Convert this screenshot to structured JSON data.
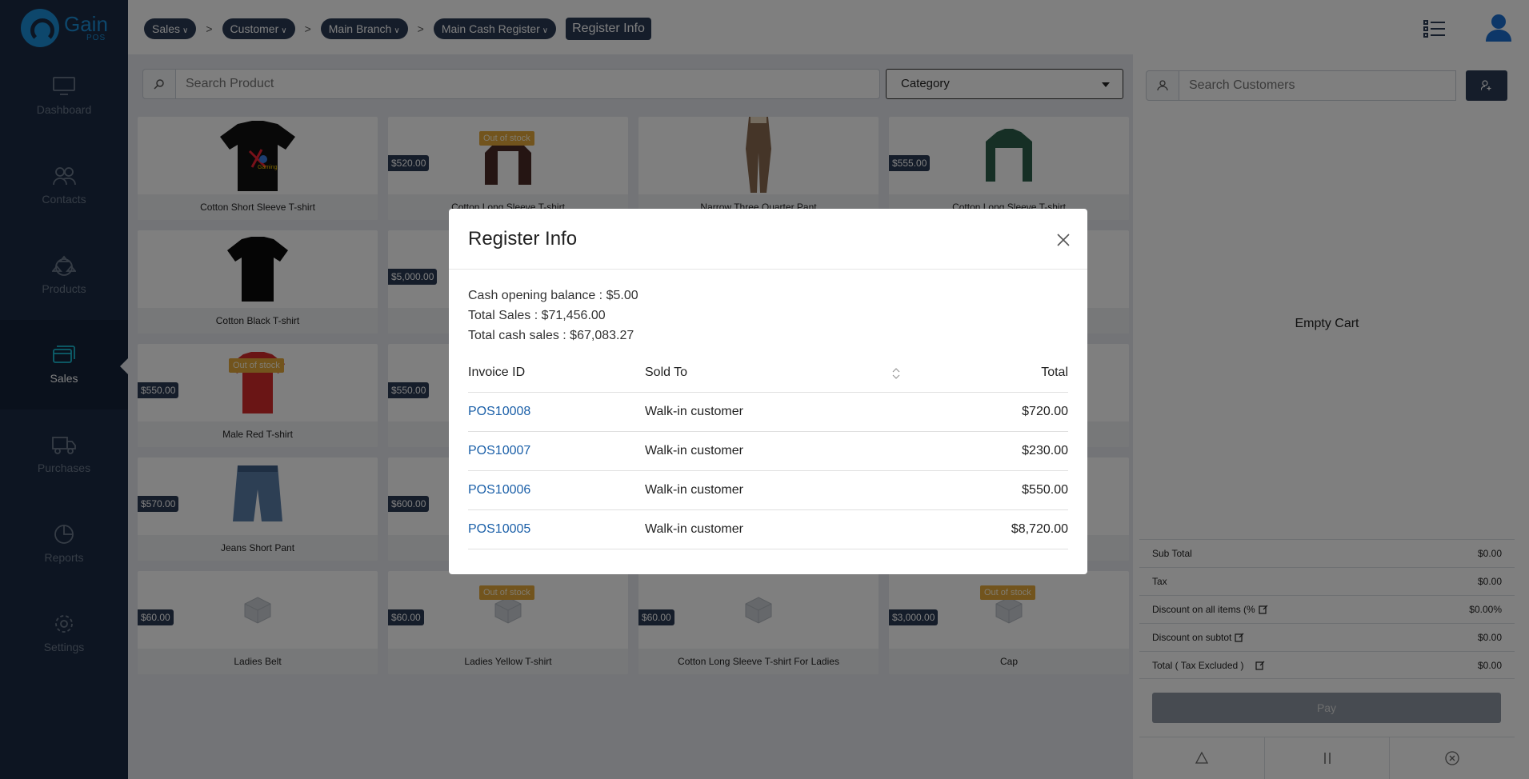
{
  "app": {
    "logo_text": "Gain",
    "logo_sub": "POS"
  },
  "sidebar": {
    "items": [
      {
        "label": "Dashboard",
        "icon": "monitor-icon",
        "active": false
      },
      {
        "label": "Contacts",
        "icon": "users-icon",
        "active": false
      },
      {
        "label": "Products",
        "icon": "products-icon",
        "active": false
      },
      {
        "label": "Sales",
        "icon": "sales-icon",
        "active": true
      },
      {
        "label": "Purchases",
        "icon": "truck-icon",
        "active": false
      },
      {
        "label": "Reports",
        "icon": "pie-chart-icon",
        "active": false
      },
      {
        "label": "Settings",
        "icon": "gear-icon",
        "active": false
      }
    ]
  },
  "breadcrumb": {
    "items": [
      "Sales",
      "Customer",
      "Main Branch",
      "Main Cash Register"
    ],
    "separator": ">",
    "current": "Register Info"
  },
  "search": {
    "placeholder": "Search Product"
  },
  "category": {
    "label": "Category"
  },
  "products": [
    {
      "name": "Cotton Short Sleeve T-shirt",
      "price": "",
      "out_of_stock": false
    },
    {
      "name": "Cotton Long Sleeve T-shirt",
      "price": "$520.00",
      "out_of_stock": true
    },
    {
      "name": "Narrow Three Quarter Pant",
      "price": "",
      "out_of_stock": false
    },
    {
      "name": "Cotton Long Sleeve T-shirt",
      "price": "$555.00",
      "out_of_stock": false
    },
    {
      "name": "Cotton Black T-shirt",
      "price": "",
      "out_of_stock": false
    },
    {
      "name": "",
      "price": "$5,000.00",
      "out_of_stock": false
    },
    {
      "name": "",
      "price": "",
      "out_of_stock": false
    },
    {
      "name": "",
      "price": "",
      "out_of_stock": false
    },
    {
      "name": "Male Red T-shirt",
      "price": "$550.00",
      "out_of_stock": true
    },
    {
      "name": "",
      "price": "$550.00",
      "out_of_stock": false
    },
    {
      "name": "",
      "price": "",
      "out_of_stock": false
    },
    {
      "name": "",
      "price": "",
      "out_of_stock": false
    },
    {
      "name": "Jeans Short Pant",
      "price": "$570.00",
      "out_of_stock": false
    },
    {
      "name": "",
      "price": "$600.00",
      "out_of_stock": false
    },
    {
      "name": "",
      "price": "",
      "out_of_stock": false
    },
    {
      "name": "",
      "price": "",
      "out_of_stock": false
    },
    {
      "name": "Ladies Belt",
      "price": "$60.00",
      "out_of_stock": false
    },
    {
      "name": "Ladies Yellow T-shirt",
      "price": "$60.00",
      "out_of_stock": true
    },
    {
      "name": "Cotton Long Sleeve T-shirt For Ladies",
      "price": "$60.00",
      "out_of_stock": false
    },
    {
      "name": "Cap",
      "price": "$3,000.00",
      "out_of_stock": true
    }
  ],
  "out_of_stock_label": "Out of stock",
  "cart": {
    "customer_placeholder": "Search Customers",
    "empty_text": "Empty Cart",
    "summary": [
      {
        "label": "Sub Total",
        "value": "$0.00",
        "editable": false
      },
      {
        "label": "Tax",
        "value": "$0.00",
        "editable": false
      },
      {
        "label": "Discount on all items (%",
        "value": "$0.00%",
        "editable": true
      },
      {
        "label": "Discount on subtot",
        "value": "$0.00",
        "editable": true
      },
      {
        "label": "Total ( Tax Excluded )",
        "value": "$0.00",
        "editable": true
      }
    ],
    "pay_label": "Pay"
  },
  "modal": {
    "title": "Register Info",
    "stats": [
      "Cash opening balance : $5.00",
      "Total Sales : $71,456.00",
      "Total cash sales : $67,083.27"
    ],
    "columns": [
      "Invoice ID",
      "Sold To",
      "Total"
    ],
    "rows": [
      {
        "id": "POS10008",
        "sold_to": "Walk-in customer",
        "total": "$720.00"
      },
      {
        "id": "POS10007",
        "sold_to": "Walk-in customer",
        "total": "$230.00"
      },
      {
        "id": "POS10006",
        "sold_to": "Walk-in customer",
        "total": "$550.00"
      },
      {
        "id": "POS10005",
        "sold_to": "Walk-in customer",
        "total": "$8,720.00"
      }
    ]
  },
  "colors": {
    "sidebar_bg": "#1b2b45",
    "accent": "#1a8fd8",
    "active_icon": "#1ac1d8",
    "crumb_bg": "#2b3a55",
    "out_of_stock": "#e5a93a",
    "link": "#1a5fa8"
  }
}
